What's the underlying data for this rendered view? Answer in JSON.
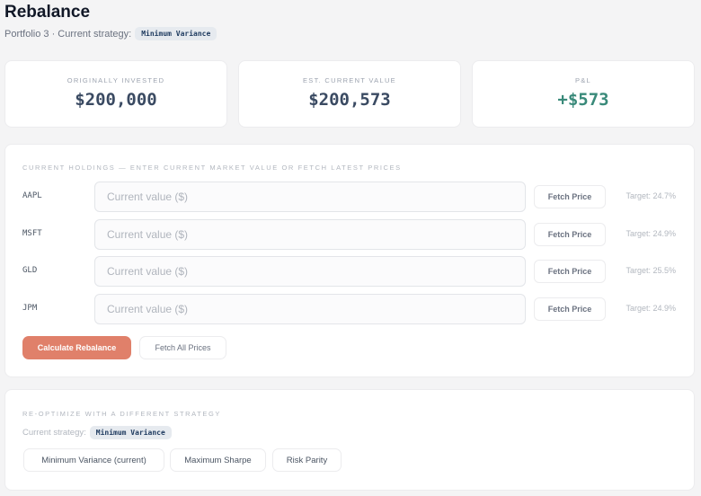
{
  "page": {
    "title": "Rebalance",
    "subtitle_prefix": "Portfolio 3 · Current strategy:",
    "strategy_pill": "Minimum Variance"
  },
  "stats": [
    {
      "label": "Originally Invested",
      "value": "$200,000"
    },
    {
      "label": "Est. Current Value",
      "value": "$200,573"
    },
    {
      "label": "P&L",
      "value": "+$573"
    }
  ],
  "holdings": {
    "title": "Current holdings — enter current market value or fetch latest prices",
    "placeholder": "Current value ($)",
    "fetch_label": "Fetch Price",
    "rows": [
      {
        "ticker": "AAPL",
        "target": "Target: 24.7%"
      },
      {
        "ticker": "MSFT",
        "target": "Target: 24.9%"
      },
      {
        "ticker": "GLD",
        "target": "Target: 25.5%"
      },
      {
        "ticker": "JPM",
        "target": "Target: 24.9%"
      }
    ],
    "calculate_label": "Calculate Rebalance",
    "fetch_all_label": "Fetch All Prices"
  },
  "reoptimize": {
    "title": "Re-optimize with a different strategy",
    "current_label": "Current strategy:",
    "current_value": "Minimum Variance",
    "options": [
      "Minimum Variance (current)",
      "Maximum Sharpe",
      "Risk Parity"
    ]
  },
  "colors": {
    "primary_button": "#e0806a",
    "positive": "#3a8a7a",
    "stat_value": "#3a4a62"
  }
}
